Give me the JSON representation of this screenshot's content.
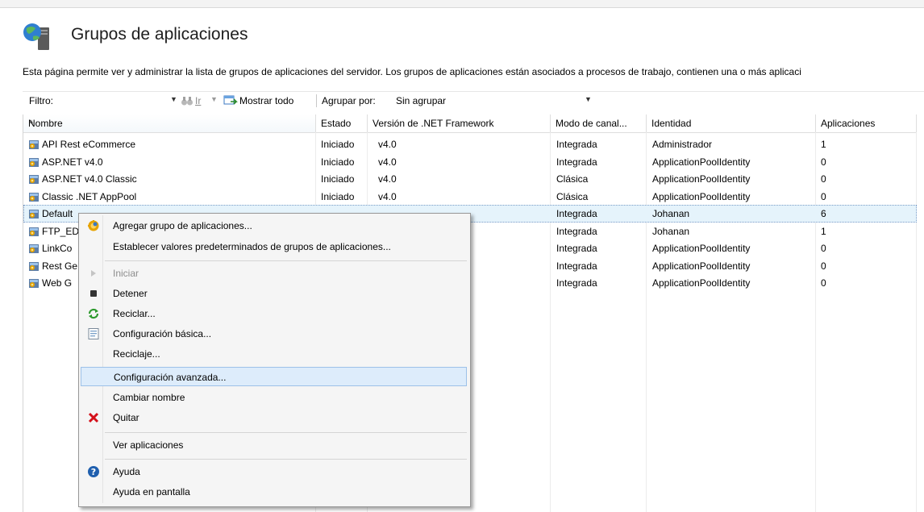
{
  "header": {
    "title": "Grupos de aplicaciones",
    "description": "Esta página permite ver y administrar la lista de grupos de aplicaciones del servidor. Los grupos de aplicaciones están asociados a procesos de trabajo, contienen una o más aplicaci"
  },
  "toolbar": {
    "filter_label": "Filtro:",
    "filter_value": "",
    "go_label": "Ir",
    "show_all_label": "Mostrar todo",
    "group_by_label": "Agrupar por:",
    "group_by_value": "Sin agrupar"
  },
  "table": {
    "columns": [
      "Nombre",
      "Estado",
      "Versión de .NET Framework",
      "Modo de canal...",
      "Identidad",
      "Aplicaciones"
    ],
    "rows": [
      {
        "name": "API Rest eCommerce",
        "state": "Iniciado",
        "net": "v4.0",
        "mode": "Integrada",
        "identity": "Administrador",
        "apps": "1"
      },
      {
        "name": "ASP.NET v4.0",
        "state": "Iniciado",
        "net": "v4.0",
        "mode": "Integrada",
        "identity": "ApplicationPoolIdentity",
        "apps": "0"
      },
      {
        "name": "ASP.NET v4.0 Classic",
        "state": "Iniciado",
        "net": "v4.0",
        "mode": "Clásica",
        "identity": "ApplicationPoolIdentity",
        "apps": "0"
      },
      {
        "name": "Classic .NET AppPool",
        "state": "Iniciado",
        "net": "v4.0",
        "mode": "Clásica",
        "identity": "ApplicationPoolIdentity",
        "apps": "0"
      },
      {
        "name": "Default",
        "state": "",
        "net": "",
        "mode": "Integrada",
        "identity": "Johanan",
        "apps": "6"
      },
      {
        "name": "FTP_ED",
        "state": "",
        "net": "",
        "mode": "Integrada",
        "identity": "Johanan",
        "apps": "1"
      },
      {
        "name": "LinkCo",
        "state": "",
        "net": "",
        "mode": "Integrada",
        "identity": "ApplicationPoolIdentity",
        "apps": "0"
      },
      {
        "name": "Rest Ge",
        "state": "",
        "net": "",
        "mode": "Integrada",
        "identity": "ApplicationPoolIdentity",
        "apps": "0"
      },
      {
        "name": "Web G",
        "state": "",
        "net": "",
        "mode": "Integrada",
        "identity": "ApplicationPoolIdentity",
        "apps": "0"
      }
    ]
  },
  "context_menu": {
    "items": [
      "Agregar grupo de aplicaciones...",
      "Establecer valores predeterminados de grupos de aplicaciones...",
      "Iniciar",
      "Detener",
      "Reciclar...",
      "Configuración básica...",
      "Reciclaje...",
      "Configuración avanzada...",
      "Cambiar nombre",
      "Quitar",
      "Ver aplicaciones",
      "Ayuda",
      "Ayuda en pantalla"
    ],
    "icons": {
      "add": "app-pool-add-icon",
      "start": "play-icon",
      "stop": "stop-icon",
      "recycle": "recycle-icon",
      "basic": "settings-page-icon",
      "remove": "red-x-icon",
      "help": "help-icon"
    }
  },
  "colors": {
    "selection": "#e5f3fb",
    "menu_highlight": "#ddecfb",
    "remove_red": "#d4101a",
    "help_blue": "#1f5fae"
  }
}
